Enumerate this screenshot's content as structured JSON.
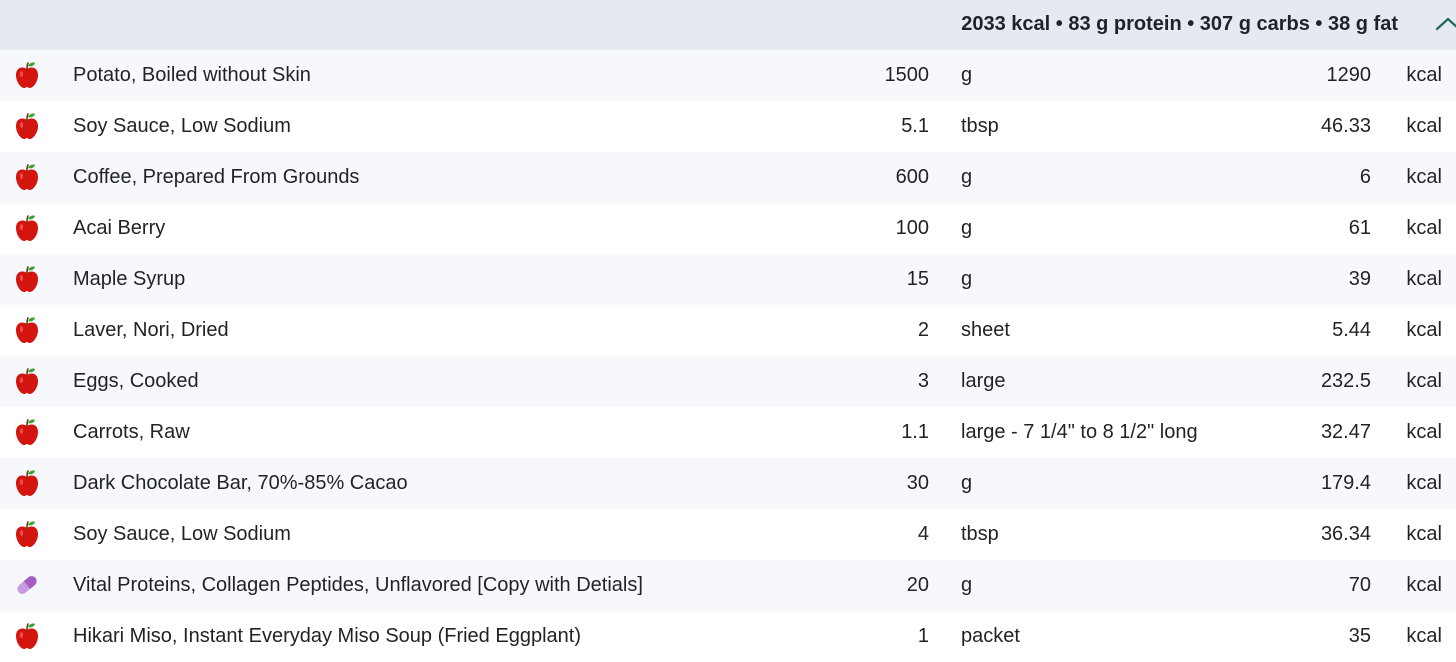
{
  "summary": {
    "text": "2033 kcal • 83 g protein • 307 g carbs • 38 g fat",
    "toggle_icon": "chevron-up-icon"
  },
  "colors": {
    "header_bg": "#e6e9ef",
    "row_alt_bg": "#f6f8fc",
    "apple_red": "#d3140f",
    "leaf_green": "#3aa335",
    "pill_purple": "#a45fc2",
    "chevron": "#1f6b5d"
  },
  "entries": [
    {
      "icon": "apple-icon",
      "name": "Potato, Boiled without Skin",
      "amount": "1500",
      "unit": "g",
      "kcal": "1290",
      "kcal_unit": "kcal"
    },
    {
      "icon": "apple-icon",
      "name": "Soy Sauce, Low Sodium",
      "amount": "5.1",
      "unit": "tbsp",
      "kcal": "46.33",
      "kcal_unit": "kcal"
    },
    {
      "icon": "apple-icon",
      "name": "Coffee, Prepared From Grounds",
      "amount": "600",
      "unit": "g",
      "kcal": "6",
      "kcal_unit": "kcal"
    },
    {
      "icon": "apple-icon",
      "name": "Acai Berry",
      "amount": "100",
      "unit": "g",
      "kcal": "61",
      "kcal_unit": "kcal"
    },
    {
      "icon": "apple-icon",
      "name": "Maple Syrup",
      "amount": "15",
      "unit": "g",
      "kcal": "39",
      "kcal_unit": "kcal"
    },
    {
      "icon": "apple-icon",
      "name": "Laver, Nori, Dried",
      "amount": "2",
      "unit": "sheet",
      "kcal": "5.44",
      "kcal_unit": "kcal"
    },
    {
      "icon": "apple-icon",
      "name": "Eggs, Cooked",
      "amount": "3",
      "unit": "large",
      "kcal": "232.5",
      "kcal_unit": "kcal"
    },
    {
      "icon": "apple-icon",
      "name": "Carrots, Raw",
      "amount": "1.1",
      "unit": "large - 7 1/4\" to 8 1/2\" long",
      "kcal": "32.47",
      "kcal_unit": "kcal"
    },
    {
      "icon": "apple-icon",
      "name": "Dark Chocolate Bar, 70%-85% Cacao",
      "amount": "30",
      "unit": "g",
      "kcal": "179.4",
      "kcal_unit": "kcal"
    },
    {
      "icon": "apple-icon",
      "name": "Soy Sauce, Low Sodium",
      "amount": "4",
      "unit": "tbsp",
      "kcal": "36.34",
      "kcal_unit": "kcal"
    },
    {
      "icon": "pill-icon",
      "name": "Vital Proteins, Collagen Peptides, Unflavored [Copy with Detials]",
      "amount": "20",
      "unit": "g",
      "kcal": "70",
      "kcal_unit": "kcal"
    },
    {
      "icon": "apple-icon",
      "name": "Hikari Miso, Instant Everyday Miso Soup (Fried Eggplant)",
      "amount": "1",
      "unit": "packet",
      "kcal": "35",
      "kcal_unit": "kcal"
    }
  ]
}
